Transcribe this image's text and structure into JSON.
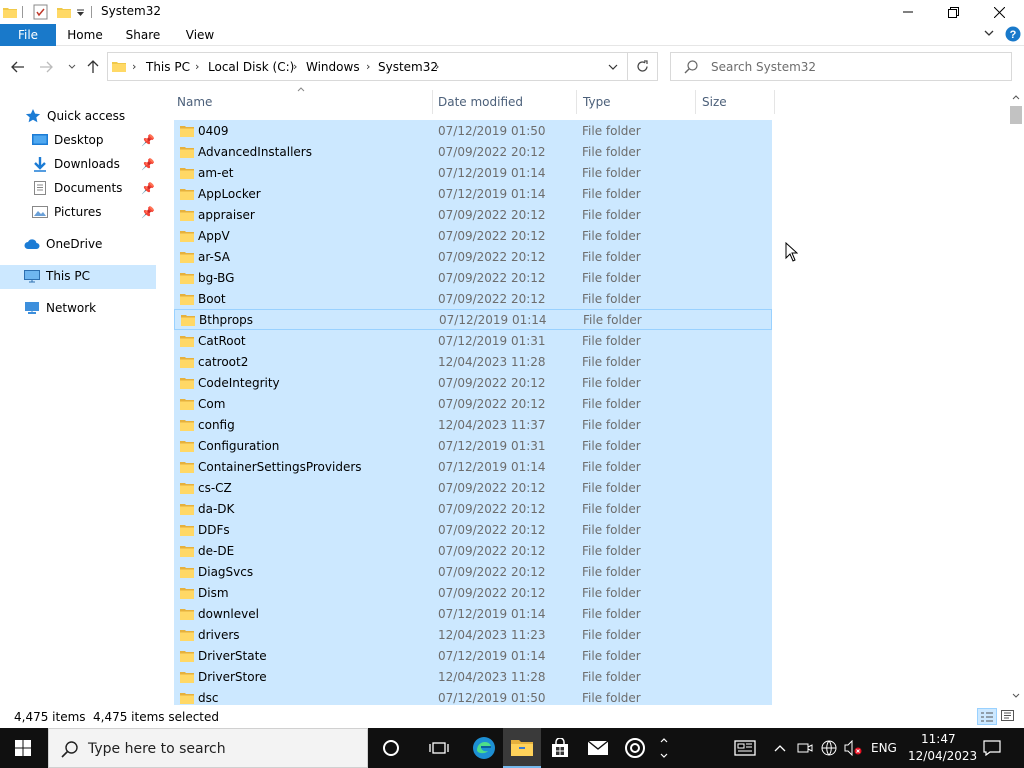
{
  "window": {
    "title": "System32",
    "controls": {
      "minimize": "minimize-icon",
      "maximize": "restore-icon",
      "close": "close-icon"
    }
  },
  "ribbon": {
    "tabs": [
      "File",
      "Home",
      "Share",
      "View"
    ],
    "accent": "#1979ca"
  },
  "address": {
    "crumbs": [
      "This PC",
      "Local Disk (C:)",
      "Windows",
      "System32"
    ],
    "search_placeholder": "Search System32"
  },
  "nav": {
    "items": [
      {
        "label": "Quick access",
        "icon": "star-icon",
        "pinned": false
      },
      {
        "label": "Desktop",
        "icon": "desktop-icon",
        "pinned": true
      },
      {
        "label": "Downloads",
        "icon": "download-icon",
        "pinned": true
      },
      {
        "label": "Documents",
        "icon": "documents-icon",
        "pinned": true
      },
      {
        "label": "Pictures",
        "icon": "pictures-icon",
        "pinned": true
      },
      {
        "label": "OneDrive",
        "icon": "cloud-icon",
        "pinned": false
      },
      {
        "label": "This PC",
        "icon": "computer-icon",
        "pinned": false,
        "selected": true
      },
      {
        "label": "Network",
        "icon": "network-icon",
        "pinned": false
      }
    ]
  },
  "columns": [
    "Name",
    "Date modified",
    "Type",
    "Size"
  ],
  "files": [
    {
      "name": "0409",
      "date": "07/12/2019 01:50",
      "type": "File folder"
    },
    {
      "name": "AdvancedInstallers",
      "date": "07/09/2022 20:12",
      "type": "File folder"
    },
    {
      "name": "am-et",
      "date": "07/12/2019 01:14",
      "type": "File folder"
    },
    {
      "name": "AppLocker",
      "date": "07/12/2019 01:14",
      "type": "File folder"
    },
    {
      "name": "appraiser",
      "date": "07/09/2022 20:12",
      "type": "File folder"
    },
    {
      "name": "AppV",
      "date": "07/09/2022 20:12",
      "type": "File folder"
    },
    {
      "name": "ar-SA",
      "date": "07/09/2022 20:12",
      "type": "File folder"
    },
    {
      "name": "bg-BG",
      "date": "07/09/2022 20:12",
      "type": "File folder"
    },
    {
      "name": "Boot",
      "date": "07/09/2022 20:12",
      "type": "File folder"
    },
    {
      "name": "Bthprops",
      "date": "07/12/2019 01:14",
      "type": "File folder"
    },
    {
      "name": "CatRoot",
      "date": "07/12/2019 01:31",
      "type": "File folder"
    },
    {
      "name": "catroot2",
      "date": "12/04/2023 11:28",
      "type": "File folder"
    },
    {
      "name": "CodeIntegrity",
      "date": "07/09/2022 20:12",
      "type": "File folder"
    },
    {
      "name": "Com",
      "date": "07/09/2022 20:12",
      "type": "File folder"
    },
    {
      "name": "config",
      "date": "12/04/2023 11:37",
      "type": "File folder"
    },
    {
      "name": "Configuration",
      "date": "07/12/2019 01:31",
      "type": "File folder"
    },
    {
      "name": "ContainerSettingsProviders",
      "date": "07/12/2019 01:14",
      "type": "File folder"
    },
    {
      "name": "cs-CZ",
      "date": "07/09/2022 20:12",
      "type": "File folder"
    },
    {
      "name": "da-DK",
      "date": "07/09/2022 20:12",
      "type": "File folder"
    },
    {
      "name": "DDFs",
      "date": "07/09/2022 20:12",
      "type": "File folder"
    },
    {
      "name": "de-DE",
      "date": "07/09/2022 20:12",
      "type": "File folder"
    },
    {
      "name": "DiagSvcs",
      "date": "07/09/2022 20:12",
      "type": "File folder"
    },
    {
      "name": "Dism",
      "date": "07/09/2022 20:12",
      "type": "File folder"
    },
    {
      "name": "downlevel",
      "date": "07/12/2019 01:14",
      "type": "File folder"
    },
    {
      "name": "drivers",
      "date": "12/04/2023 11:23",
      "type": "File folder"
    },
    {
      "name": "DriverState",
      "date": "07/12/2019 01:14",
      "type": "File folder"
    },
    {
      "name": "DriverStore",
      "date": "12/04/2023 11:28",
      "type": "File folder"
    },
    {
      "name": "dsc",
      "date": "07/12/2019 01:50",
      "type": "File folder"
    }
  ],
  "status": {
    "items": "4,475 items",
    "selected": "4,475 items selected"
  },
  "taskbar": {
    "search_placeholder": "Type here to search",
    "language": "ENG",
    "time": "11:47",
    "date": "12/04/2023"
  }
}
